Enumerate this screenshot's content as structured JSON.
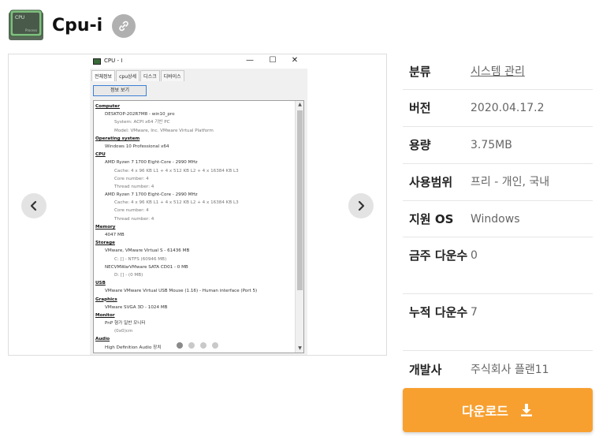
{
  "header": {
    "title": "Cpu-i",
    "icon": "cpu-chip-icon",
    "link_icon": "link-icon"
  },
  "gallery": {
    "prev_icon": "chevron-left-icon",
    "next_icon": "chevron-right-icon",
    "dot_count": 4,
    "active_dot": 0,
    "screenshot": {
      "window_title": "CPU - I",
      "controls": [
        "—",
        "☐",
        "✕"
      ],
      "tabs": [
        "전체정보",
        "cpu상세",
        "디스크",
        "디바이스"
      ],
      "active_tab": 0,
      "button_label": "정보 보기",
      "lines": [
        {
          "t": "Computer",
          "s": "h"
        },
        {
          "t": "DESKTOP-202R7M8 - win10_pro",
          "s": "l1"
        },
        {
          "t": "System: ACPI x64 기반 PC",
          "s": "l2"
        },
        {
          "t": "Model: VMware, Inc. VMware Virtual Platform",
          "s": "l2"
        },
        {
          "t": "Operating system",
          "s": "h"
        },
        {
          "t": "Windows 10 Professional x64",
          "s": "l1"
        },
        {
          "t": "CPU",
          "s": "h"
        },
        {
          "t": "AMD Ryzen 7 1700 Eight-Core - 2990 MHz",
          "s": "l1"
        },
        {
          "t": "Cache: 4 x 96 KB L1 + 4 x 512 KB L2 + 4 x 16384 KB L3",
          "s": "l2"
        },
        {
          "t": "Core number: 4",
          "s": "l2"
        },
        {
          "t": "Thread number: 4",
          "s": "l2"
        },
        {
          "t": "AMD Ryzen 7 1700 Eight-Core - 2990 MHz",
          "s": "l1"
        },
        {
          "t": "Cache: 4 x 96 KB L1 + 4 x 512 KB L2 + 4 x 16384 KB L3",
          "s": "l2"
        },
        {
          "t": "Core number: 4",
          "s": "l2"
        },
        {
          "t": "Thread number: 4",
          "s": "l2"
        },
        {
          "t": "Memory",
          "s": "h"
        },
        {
          "t": "4047 MB",
          "s": "l1"
        },
        {
          "t": "Storage",
          "s": "h"
        },
        {
          "t": "VMware, VMware Virtual S - 61436 MB",
          "s": "l1"
        },
        {
          "t": "C: [] - NTFS (60946 MB)",
          "s": "l2"
        },
        {
          "t": "NECVMWarVMware SATA CD01 - 0 MB",
          "s": "l1"
        },
        {
          "t": "D: [] - (0 MB)",
          "s": "l2"
        },
        {
          "t": "USB",
          "s": "h"
        },
        {
          "t": "VMware VMware Virtual USB Mouse (1.16) - Human interface (Port 5)",
          "s": "l1"
        },
        {
          "t": "Graphics",
          "s": "h"
        },
        {
          "t": "VMware SVGA 3D - 1024 MB",
          "s": "l1"
        },
        {
          "t": "Monitor",
          "s": "h"
        },
        {
          "t": "PnP 형가 일반 모니터",
          "s": "l1"
        },
        {
          "t": "(0x0)cm",
          "s": "l2"
        },
        {
          "t": "Audio",
          "s": "h"
        },
        {
          "t": "High Definition Audio 장치",
          "s": "l1"
        }
      ]
    }
  },
  "info": {
    "rows": [
      {
        "label": "분류",
        "value": "시스템 관리",
        "link": true
      },
      {
        "label": "버전",
        "value": "2020.04.17.2",
        "link": false
      },
      {
        "label": "용량",
        "value": "3.75MB",
        "link": false
      },
      {
        "label": "사용범위",
        "value": "프리 - 개인, 국내",
        "link": false
      },
      {
        "label": "지원 OS",
        "value": "Windows",
        "link": false
      },
      {
        "label": "금주 다운수",
        "value": "0",
        "link": false
      },
      {
        "label": "누적 다운수",
        "value": "7",
        "link": false
      },
      {
        "label": "개발사",
        "value": "주식회사 플랜11",
        "link": false
      }
    ]
  },
  "download": {
    "label": "다운로드",
    "icon": "download-icon"
  },
  "colors": {
    "accent": "#f7a030",
    "link_button": "#b0b0b0",
    "nav_button": "#e3e3e3"
  }
}
